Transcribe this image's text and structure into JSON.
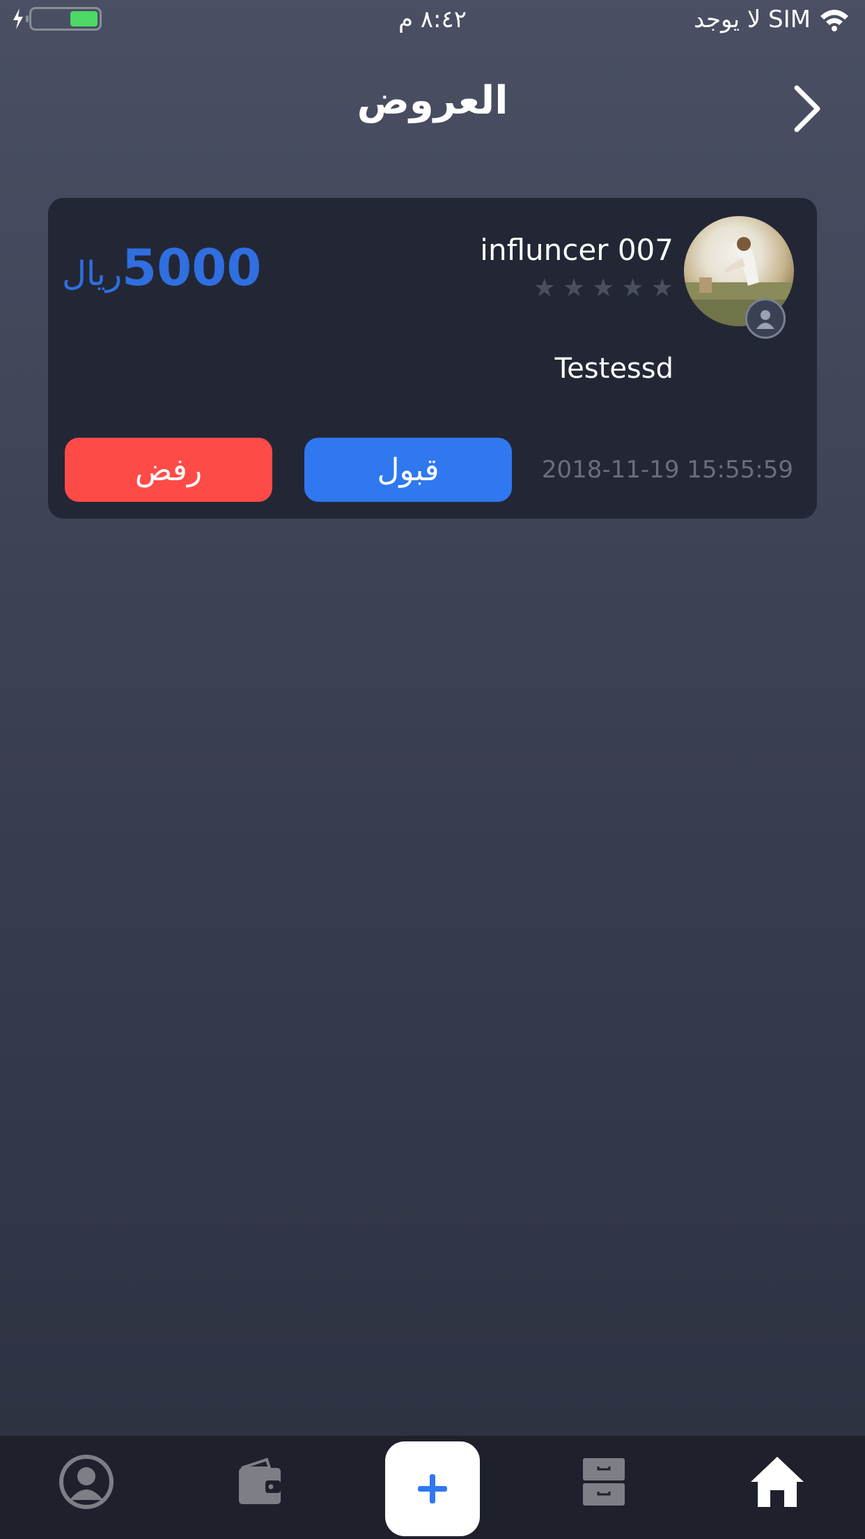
{
  "status_bar": {
    "carrier": "لا يوجد SIM",
    "time": "٨:٤٢ م"
  },
  "header": {
    "title": "العروض"
  },
  "offer": {
    "influencer_name": "influncer 007",
    "rating": 0,
    "max_rating": 5,
    "price_amount": "5000",
    "price_currency": "ريال",
    "description": "Testessd",
    "date": "2018-11-19 15:55:59",
    "accept_label": "قبول",
    "reject_label": "رفض"
  },
  "tab_bar": {
    "icons": [
      "profile-icon",
      "wallet-icon",
      "add-icon",
      "archive-icon",
      "home-icon"
    ],
    "active": "home-icon"
  },
  "colors": {
    "accent": "#2f78f0",
    "reject": "#ff4b47",
    "price": "#2f6fe0"
  }
}
